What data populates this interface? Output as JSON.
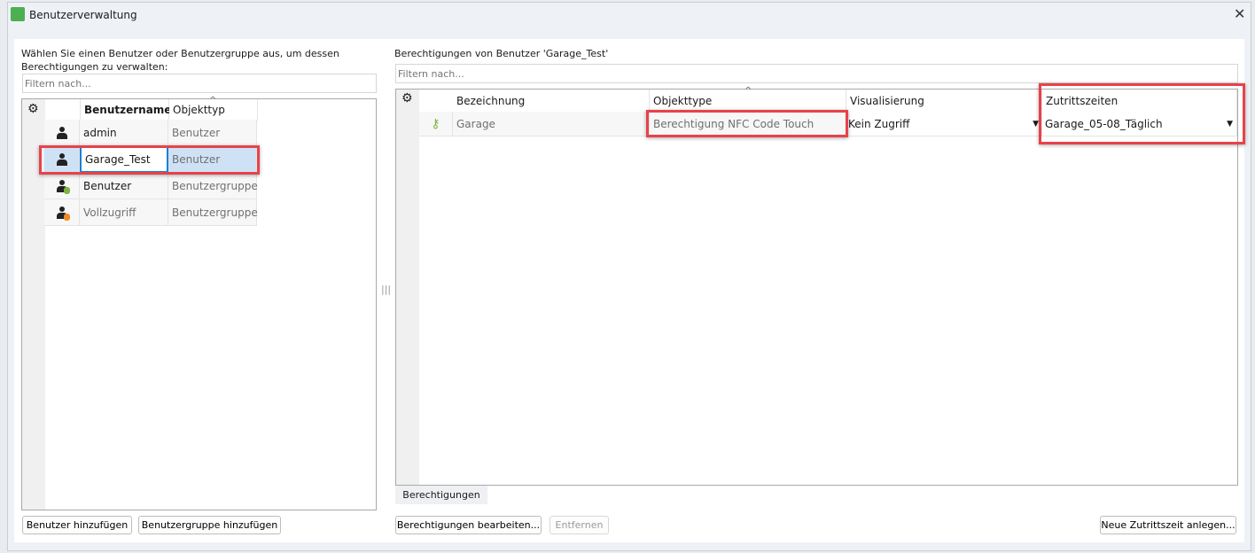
{
  "window": {
    "title": "Benutzerverwaltung",
    "close_icon": "close-icon"
  },
  "left": {
    "instruction": "Wählen Sie einen Benutzer oder Benutzergruppe aus, um dessen Berechtigungen zu verwalten:",
    "filter_placeholder": "Filtern nach...",
    "columns": [
      "Benutzername",
      "Objekttyp"
    ],
    "rows": [
      {
        "name": "admin",
        "type": "Benutzer",
        "icon": "user-icon"
      },
      {
        "name": "Garage_Test",
        "type": "Benutzer",
        "icon": "user-icon",
        "selected": true
      },
      {
        "name": "Benutzer",
        "type": "Benutzergruppe",
        "icon": "user-group-green-icon"
      },
      {
        "name": "Vollzugriff",
        "type": "Benutzergruppe",
        "icon": "user-group-orange-icon"
      }
    ],
    "buttons": {
      "add_user": "Benutzer hinzufügen",
      "add_group": "Benutzergruppe hinzufügen"
    }
  },
  "right": {
    "heading": "Berechtigungen von Benutzer 'Garage_Test'",
    "filter_placeholder": "Filtern nach...",
    "columns": [
      "Bezeichnung",
      "Objekttype",
      "Visualisierung",
      "Zutrittszeiten"
    ],
    "rows": [
      {
        "bezeichnung": "Garage",
        "objekttype": "Berechtigung NFC Code Touch",
        "visualisierung": "Kein Zugriff",
        "zutrittszeiten": "Garage_05-08_Täglich",
        "icon": "key-icon"
      }
    ],
    "tab": "Berechtigungen",
    "buttons": {
      "edit": "Berechtigungen bearbeiten...",
      "remove": "Entfernen",
      "new_time": "Neue Zutrittszeit anlegen..."
    }
  },
  "colors": {
    "highlight": "#e8424a",
    "selection": "#cfe2f5",
    "focus": "#1a7fd9"
  }
}
